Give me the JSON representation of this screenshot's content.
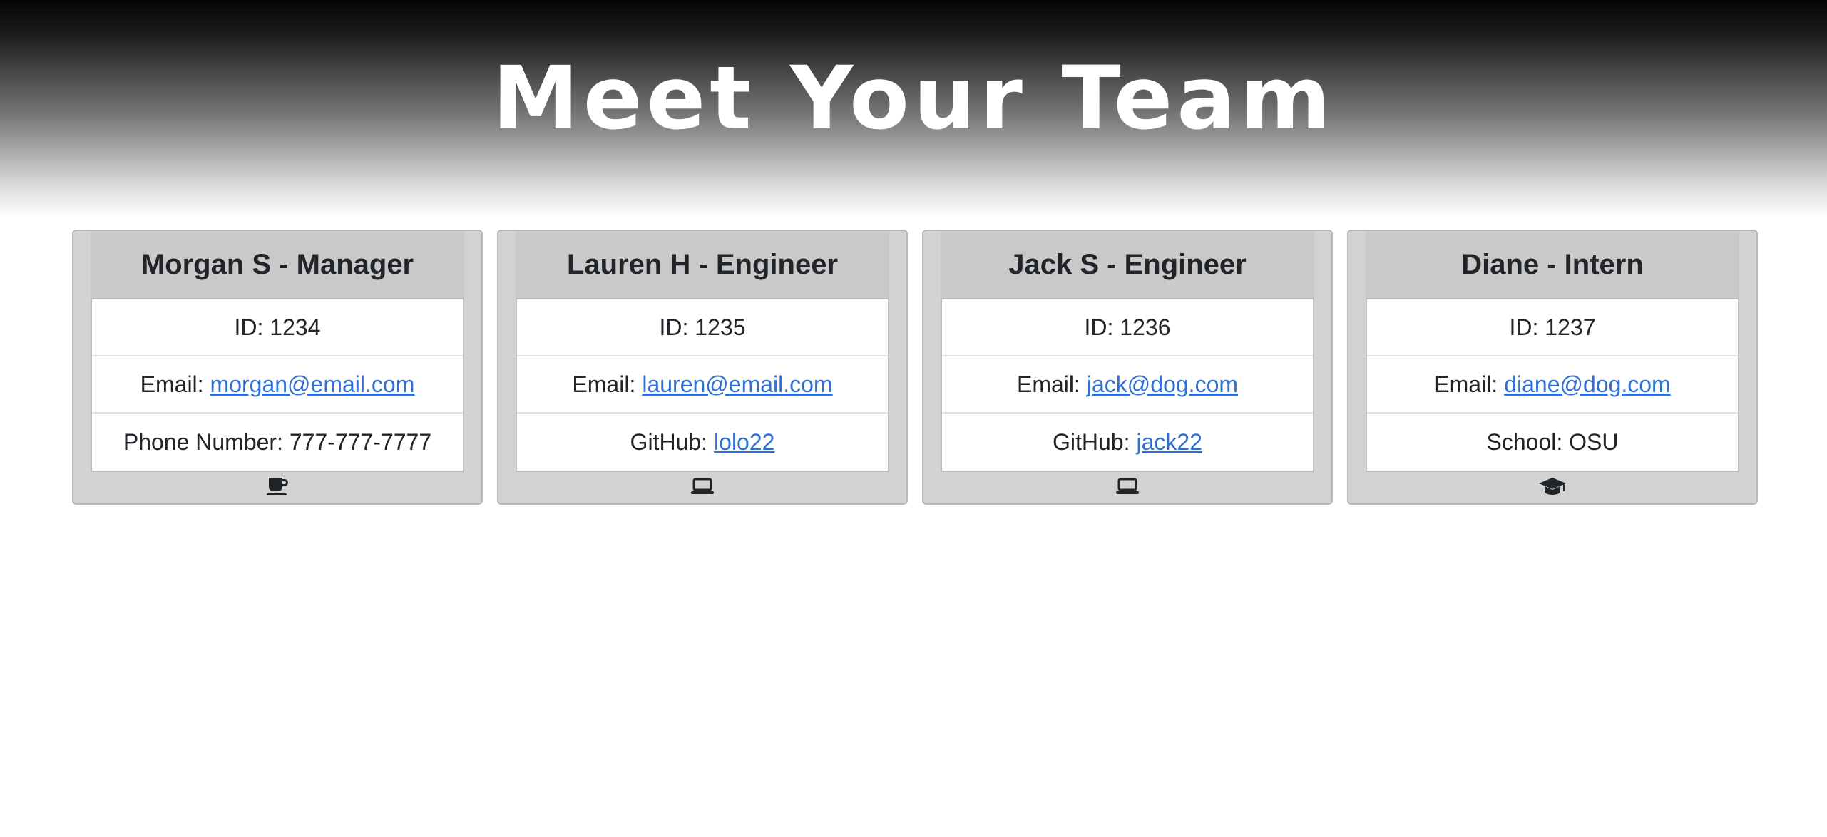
{
  "page": {
    "title": "Meet Your Team"
  },
  "colors": {
    "header_gradient_top": "#050505",
    "header_gradient_bottom": "#fbfbfb",
    "card_background": "#d2d2d2",
    "card_header_background": "#c9c9c9",
    "link": "#2f6fd6"
  },
  "team": [
    {
      "header": "Morgan S - Manager",
      "id_text": "ID: 1234",
      "email_label": "Email:",
      "email": "morgan@email.com",
      "extra_text": "Phone Number: 777-777-7777",
      "icon": "coffee-icon"
    },
    {
      "header": "Lauren H - Engineer",
      "id_text": "ID: 1235",
      "email_label": "Email:",
      "email": "lauren@email.com",
      "extra_label": "GitHub:",
      "extra_link": "lolo22",
      "icon": "laptop-icon"
    },
    {
      "header": "Jack S - Engineer",
      "id_text": "ID: 1236",
      "email_label": "Email:",
      "email": "jack@dog.com",
      "extra_label": "GitHub:",
      "extra_link": "jack22",
      "icon": "laptop-icon"
    },
    {
      "header": "Diane - Intern",
      "id_text": "ID: 1237",
      "email_label": "Email:",
      "email": "diane@dog.com",
      "extra_text": "School: OSU",
      "icon": "graduation-cap-icon"
    }
  ]
}
